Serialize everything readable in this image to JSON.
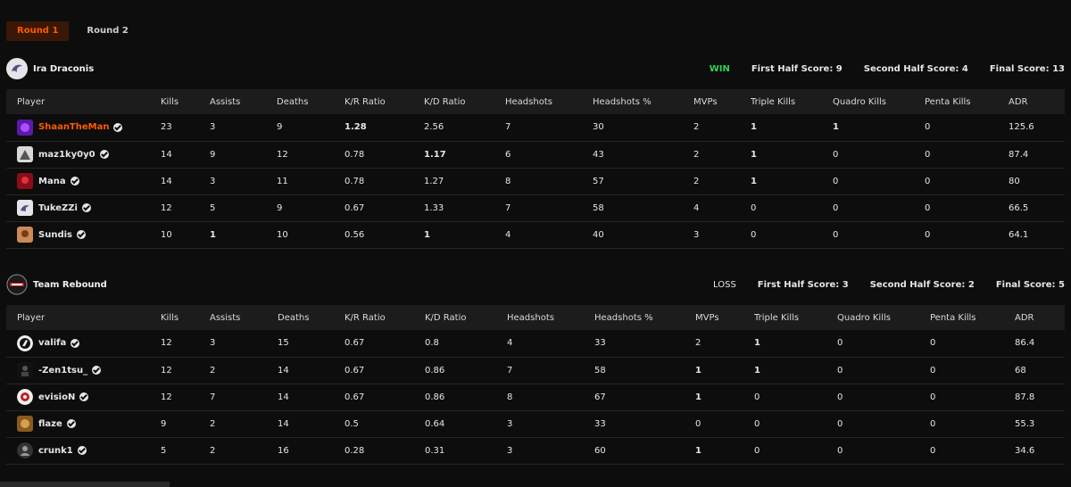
{
  "tabs": [
    "Round 1",
    "Round 2"
  ],
  "columns": [
    "Player",
    "Kills",
    "Assists",
    "Deaths",
    "K/R Ratio",
    "K/D Ratio",
    "Headshots",
    "Headshots %",
    "MVPs",
    "Triple Kills",
    "Quadro Kills",
    "Penta Kills",
    "ADR"
  ],
  "teams": [
    {
      "name": "Ira Draconis",
      "result": "WIN",
      "first_half": "First Half Score: 9",
      "second_half": "Second Half Score: 4",
      "final": "Final Score: 13",
      "players": [
        {
          "name": "ShaanTheMan",
          "kills": "23",
          "assists": "3",
          "deaths": "9",
          "kr": "1.28",
          "kd": "2.56",
          "hs": "7",
          "hsp": "30",
          "mvps": "2",
          "triple": "1",
          "quadro": "1",
          "penta": "0",
          "adr": "125.6"
        },
        {
          "name": "maz1ky0y0",
          "kills": "14",
          "assists": "9",
          "deaths": "12",
          "kr": "0.78",
          "kd": "1.17",
          "hs": "6",
          "hsp": "43",
          "mvps": "2",
          "triple": "1",
          "quadro": "0",
          "penta": "0",
          "adr": "87.4"
        },
        {
          "name": "Mana",
          "kills": "14",
          "assists": "3",
          "deaths": "11",
          "kr": "0.78",
          "kd": "1.27",
          "hs": "8",
          "hsp": "57",
          "mvps": "2",
          "triple": "1",
          "quadro": "0",
          "penta": "0",
          "adr": "80"
        },
        {
          "name": "TukeZZi",
          "kills": "12",
          "assists": "5",
          "deaths": "9",
          "kr": "0.67",
          "kd": "1.33",
          "hs": "7",
          "hsp": "58",
          "mvps": "4",
          "triple": "0",
          "quadro": "0",
          "penta": "0",
          "adr": "66.5"
        },
        {
          "name": "Sundis",
          "kills": "10",
          "assists": "1",
          "deaths": "10",
          "kr": "0.56",
          "kd": "1",
          "hs": "4",
          "hsp": "40",
          "mvps": "3",
          "triple": "0",
          "quadro": "0",
          "penta": "0",
          "adr": "64.1"
        }
      ]
    },
    {
      "name": "Team Rebound",
      "result": "LOSS",
      "first_half": "First Half Score: 3",
      "second_half": "Second Half Score: 2",
      "final": "Final Score: 5",
      "players": [
        {
          "name": "valifa",
          "kills": "12",
          "assists": "3",
          "deaths": "15",
          "kr": "0.67",
          "kd": "0.8",
          "hs": "4",
          "hsp": "33",
          "mvps": "2",
          "triple": "1",
          "quadro": "0",
          "penta": "0",
          "adr": "86.4"
        },
        {
          "name": "-Zen1tsu_",
          "kills": "12",
          "assists": "2",
          "deaths": "14",
          "kr": "0.67",
          "kd": "0.86",
          "hs": "7",
          "hsp": "58",
          "mvps": "1",
          "triple": "1",
          "quadro": "0",
          "penta": "0",
          "adr": "68"
        },
        {
          "name": "evisioN",
          "kills": "12",
          "assists": "7",
          "deaths": "14",
          "kr": "0.67",
          "kd": "0.86",
          "hs": "8",
          "hsp": "67",
          "mvps": "1",
          "triple": "0",
          "quadro": "0",
          "penta": "0",
          "adr": "87.8"
        },
        {
          "name": "flaze",
          "kills": "9",
          "assists": "2",
          "deaths": "14",
          "kr": "0.5",
          "kd": "0.64",
          "hs": "3",
          "hsp": "33",
          "mvps": "0",
          "triple": "0",
          "quadro": "0",
          "penta": "0",
          "adr": "55.3"
        },
        {
          "name": "crunk1",
          "kills": "5",
          "assists": "2",
          "deaths": "16",
          "kr": "0.28",
          "kd": "0.31",
          "hs": "3",
          "hsp": "60",
          "mvps": "1",
          "triple": "0",
          "quadro": "0",
          "penta": "0",
          "adr": "34.6"
        }
      ]
    }
  ],
  "colors": {
    "accent": "#ff5a00",
    "win": "#2dd255",
    "background": "#0d0d0d",
    "header_row": "#1c1c1c"
  }
}
